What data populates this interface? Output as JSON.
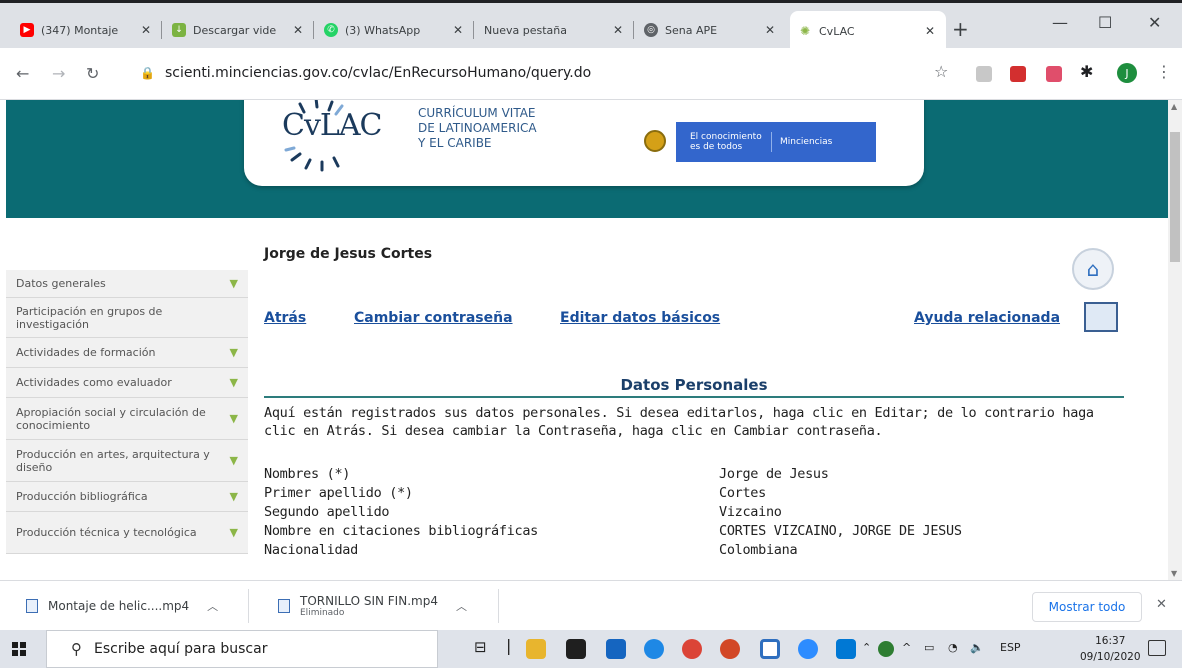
{
  "browser": {
    "tabs": [
      {
        "title": "(347) Montaje",
        "icon": "youtube-icon",
        "color": "#ff0000"
      },
      {
        "title": "Descargar vide",
        "icon": "download-site-icon",
        "color": "#7cb342"
      },
      {
        "title": "(3) WhatsApp",
        "icon": "whatsapp-icon",
        "color": "#25d366"
      },
      {
        "title": "Nueva pestaña",
        "icon": "none",
        "color": "#dee1e6"
      },
      {
        "title": "Sena APE",
        "icon": "globe-icon",
        "color": "#5f6368"
      },
      {
        "title": "CvLAC",
        "icon": "cvlac-favicon",
        "color": "#8cb648"
      }
    ],
    "url": "scienti.minciencias.gov.co/cvlac/EnRecursoHumano/query.do"
  },
  "header": {
    "logo_text": "CvLAC",
    "logo_subtitle": [
      "CURRÍCULUM VITAE",
      "DE LATINOAMERICA",
      "Y EL CARIBE"
    ],
    "gov_slogan": "El conocimiento es de todos",
    "gov_brand": "Minciencias",
    "teal": "#0b6b73"
  },
  "sidebar": {
    "items": [
      {
        "label": "Datos generales",
        "expandable": true
      },
      {
        "label": "Participación en grupos de investigación",
        "expandable": false
      },
      {
        "label": "Actividades de formación",
        "expandable": true
      },
      {
        "label": "Actividades como evaluador",
        "expandable": true
      },
      {
        "label": "Apropiación social y circulación de conocimiento",
        "expandable": true
      },
      {
        "label": "Producción en artes, arquitectura y diseño",
        "expandable": true
      },
      {
        "label": "Producción bibliográfica",
        "expandable": true
      },
      {
        "label": "Producción técnica y tecnológica",
        "expandable": true
      }
    ]
  },
  "main": {
    "person_name": "Jorge de Jesus Cortes",
    "links": {
      "back": "Atrás",
      "change_password": "Cambiar contraseña",
      "edit_basic": "Editar datos básicos",
      "help": "Ayuda relacionada"
    },
    "section_title": "Datos Personales",
    "intro": "Aquí están registrados sus datos personales. Si desea editarlos, haga clic en Editar; de lo contrario haga clic en Atrás. Si desea cambiar la Contraseña, haga clic en Cambiar contraseña.",
    "fields": [
      {
        "label": "Nombres (*)",
        "value": "Jorge de Jesus"
      },
      {
        "label": "Primer apellido (*)",
        "value": "Cortes"
      },
      {
        "label": "Segundo apellido",
        "value": "Vizcaino"
      },
      {
        "label": "Nombre en citaciones bibliográficas",
        "value": "CORTES VIZCAINO, JORGE DE JESUS"
      },
      {
        "label": "Nacionalidad",
        "value": "Colombiana"
      }
    ]
  },
  "downloads": {
    "items": [
      {
        "name": "Montaje de helic....mp4",
        "status": ""
      },
      {
        "name": "TORNILLO SIN FIN.mp4",
        "status": "Eliminado"
      }
    ],
    "show_all": "Mostrar todo"
  },
  "taskbar": {
    "search_placeholder": "Escribe aquí para buscar",
    "language": "ESP",
    "time": "16:37",
    "date": "09/10/2020"
  }
}
